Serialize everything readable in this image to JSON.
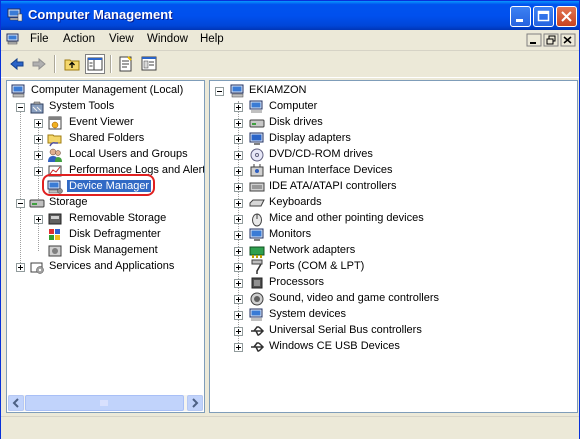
{
  "window": {
    "title": "Computer Management"
  },
  "menu": {
    "items": [
      "File",
      "Action",
      "View",
      "Window",
      "Help"
    ]
  },
  "toolbar": {
    "buttons": [
      "back-icon",
      "forward-icon",
      "up-level-icon",
      "show-hide-tree-icon",
      "properties-icon",
      "help-icon"
    ]
  },
  "left_tree": {
    "root": "Computer Management (Local)",
    "system_tools": "System Tools",
    "event_viewer": "Event Viewer",
    "shared_folders": "Shared Folders",
    "local_users": "Local Users and Groups",
    "performance": "Performance Logs and Alerts",
    "device_manager": "Device Manager",
    "storage": "Storage",
    "removable_storage": "Removable Storage",
    "disk_defrag": "Disk Defragmenter",
    "disk_mgmt": "Disk Management",
    "services_apps": "Services and Applications"
  },
  "right_tree": {
    "root": "EKIAMZON",
    "items": [
      "Computer",
      "Disk drives",
      "Display adapters",
      "DVD/CD-ROM drives",
      "Human Interface Devices",
      "IDE ATA/ATAPI controllers",
      "Keyboards",
      "Mice and other pointing devices",
      "Monitors",
      "Network adapters",
      "Ports (COM & LPT)",
      "Processors",
      "Sound, video and game controllers",
      "System devices",
      "Universal Serial Bus controllers",
      "Windows CE USB Devices"
    ]
  },
  "colors": {
    "title_bar": "#0053ee",
    "selection": "#316ac5",
    "annotation": "#e02020"
  }
}
